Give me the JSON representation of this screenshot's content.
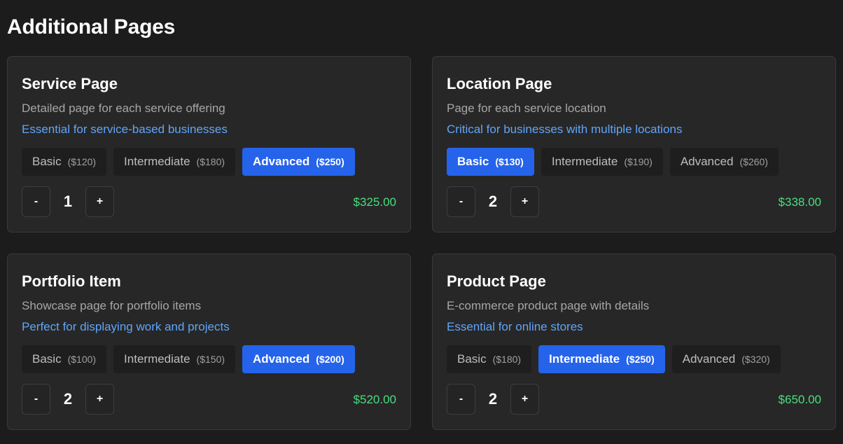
{
  "page": {
    "title": "Additional Pages"
  },
  "cards": [
    {
      "title": "Service Page",
      "description": "Detailed page for each service offering",
      "note": "Essential for service-based businesses",
      "tiers": [
        {
          "label": "Basic",
          "price": "($120)",
          "selected": false
        },
        {
          "label": "Intermediate",
          "price": "($180)",
          "selected": false
        },
        {
          "label": "Advanced",
          "price": "($250)",
          "selected": true
        }
      ],
      "minus_label": "-",
      "plus_label": "+",
      "quantity": "1",
      "total": "$325.00"
    },
    {
      "title": "Location Page",
      "description": "Page for each service location",
      "note": "Critical for businesses with multiple locations",
      "tiers": [
        {
          "label": "Basic",
          "price": "($130)",
          "selected": true
        },
        {
          "label": "Intermediate",
          "price": "($190)",
          "selected": false
        },
        {
          "label": "Advanced",
          "price": "($260)",
          "selected": false
        }
      ],
      "minus_label": "-",
      "plus_label": "+",
      "quantity": "2",
      "total": "$338.00"
    },
    {
      "title": "Portfolio Item",
      "description": "Showcase page for portfolio items",
      "note": "Perfect for displaying work and projects",
      "tiers": [
        {
          "label": "Basic",
          "price": "($100)",
          "selected": false
        },
        {
          "label": "Intermediate",
          "price": "($150)",
          "selected": false
        },
        {
          "label": "Advanced",
          "price": "($200)",
          "selected": true
        }
      ],
      "minus_label": "-",
      "plus_label": "+",
      "quantity": "2",
      "total": "$520.00"
    },
    {
      "title": "Product Page",
      "description": "E-commerce product page with details",
      "note": "Essential for online stores",
      "tiers": [
        {
          "label": "Basic",
          "price": "($180)",
          "selected": false
        },
        {
          "label": "Intermediate",
          "price": "($250)",
          "selected": true
        },
        {
          "label": "Advanced",
          "price": "($320)",
          "selected": false
        }
      ],
      "minus_label": "-",
      "plus_label": "+",
      "quantity": "2",
      "total": "$650.00"
    }
  ],
  "colors": {
    "background": "#1c1c1c",
    "card": "#272727",
    "accent": "#2563eb",
    "note": "#60a5fa",
    "total": "#4ade80"
  }
}
